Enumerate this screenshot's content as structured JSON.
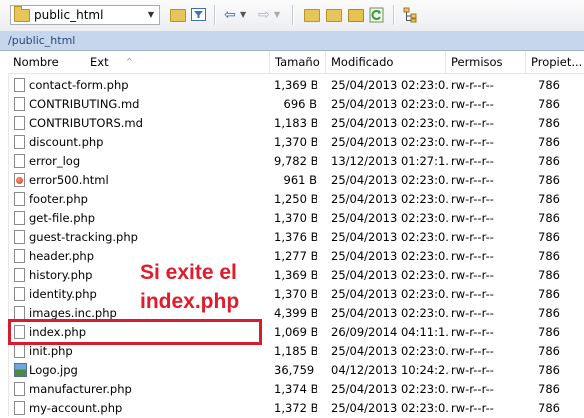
{
  "toolbar": {
    "path_combo_value": "public_html",
    "icons": [
      "folder-open-icon",
      "filter-icon",
      "back-arrow-icon",
      "forward-arrow-icon",
      "parent-folder-icon",
      "new-folder-icon",
      "bookmark-icon",
      "refresh-icon",
      "tree-icon"
    ]
  },
  "path_bar": {
    "path": "/public_html"
  },
  "columns": {
    "name": "Nombre",
    "ext": "Ext",
    "size": "Tamaño",
    "modified": "Modificado",
    "permissions": "Permisos",
    "owner": "Propiet..."
  },
  "files": [
    {
      "name": "contact-form.php",
      "size": "1,369 B",
      "modified": "25/04/2013 02:23:0...",
      "permissions": "rw-r--r--",
      "owner": "786",
      "icon": "file-icon"
    },
    {
      "name": "CONTRIBUTING.md",
      "size": "696 B",
      "modified": "25/04/2013 02:23:0...",
      "permissions": "rw-r--r--",
      "owner": "786",
      "icon": "file-icon"
    },
    {
      "name": "CONTRIBUTORS.md",
      "size": "1,183 B",
      "modified": "25/04/2013 02:23:0...",
      "permissions": "rw-r--r--",
      "owner": "786",
      "icon": "file-icon"
    },
    {
      "name": "discount.php",
      "size": "1,370 B",
      "modified": "25/04/2013 02:23:0...",
      "permissions": "rw-r--r--",
      "owner": "786",
      "icon": "file-icon"
    },
    {
      "name": "error_log",
      "size": "9,782 B",
      "modified": "13/12/2013 01:27:1...",
      "permissions": "rw-r--r--",
      "owner": "786",
      "icon": "file-icon"
    },
    {
      "name": "error500.html",
      "size": "961 B",
      "modified": "25/04/2013 02:23:0...",
      "permissions": "rw-r--r--",
      "owner": "786",
      "icon": "html-file-icon"
    },
    {
      "name": "footer.php",
      "size": "1,250 B",
      "modified": "25/04/2013 02:23:0...",
      "permissions": "rw-r--r--",
      "owner": "786",
      "icon": "file-icon"
    },
    {
      "name": "get-file.php",
      "size": "1,370 B",
      "modified": "25/04/2013 02:23:0...",
      "permissions": "rw-r--r--",
      "owner": "786",
      "icon": "file-icon"
    },
    {
      "name": "guest-tracking.php",
      "size": "1,376 B",
      "modified": "25/04/2013 02:23:0...",
      "permissions": "rw-r--r--",
      "owner": "786",
      "icon": "file-icon"
    },
    {
      "name": "header.php",
      "size": "1,277 B",
      "modified": "25/04/2013 02:23:0...",
      "permissions": "rw-r--r--",
      "owner": "786",
      "icon": "file-icon"
    },
    {
      "name": "history.php",
      "size": "1,369 B",
      "modified": "25/04/2013 02:23:0...",
      "permissions": "rw-r--r--",
      "owner": "786",
      "icon": "file-icon"
    },
    {
      "name": "identity.php",
      "size": "1,370 B",
      "modified": "25/04/2013 02:23:0...",
      "permissions": "rw-r--r--",
      "owner": "786",
      "icon": "file-icon"
    },
    {
      "name": "images.inc.php",
      "size": "4,399 B",
      "modified": "25/04/2013 02:23:0...",
      "permissions": "rw-r--r--",
      "owner": "786",
      "icon": "file-icon"
    },
    {
      "name": "index.php",
      "size": "1,069 B",
      "modified": "26/09/2014 04:11:1...",
      "permissions": "rw-r--r--",
      "owner": "786",
      "icon": "file-icon"
    },
    {
      "name": "init.php",
      "size": "1,185 B",
      "modified": "25/04/2013 02:23:0...",
      "permissions": "rw-r--r--",
      "owner": "786",
      "icon": "file-icon"
    },
    {
      "name": "Logo.jpg",
      "size": "36,759 B",
      "modified": "04/12/2013 10:24:2...",
      "permissions": "rw-r--r--",
      "owner": "786",
      "icon": "image-file-icon"
    },
    {
      "name": "manufacturer.php",
      "size": "1,374 B",
      "modified": "25/04/2013 02:23:0...",
      "permissions": "rw-r--r--",
      "owner": "786",
      "icon": "file-icon"
    },
    {
      "name": "my-account.php",
      "size": "1,372 B",
      "modified": "25/04/2013 02:23:0...",
      "permissions": "rw-r--r--",
      "owner": "786",
      "icon": "file-icon"
    }
  ],
  "annotation": {
    "line1": "Si exite el",
    "line2": "index.php",
    "color": "#e01b2b"
  }
}
